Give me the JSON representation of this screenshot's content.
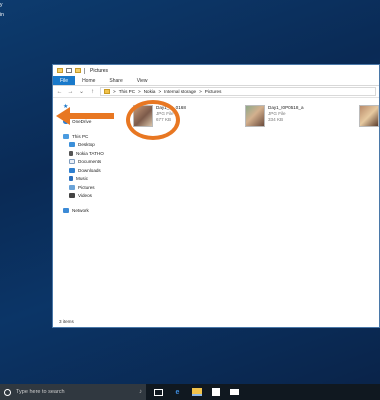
{
  "desktop": {
    "frag1": "y",
    "frag2": "in"
  },
  "window": {
    "title": "Pictures",
    "tabs": [
      "File",
      "Home",
      "Share",
      "View"
    ],
    "address": [
      "This PC",
      ">",
      "Nokia",
      ">",
      "Internal storage",
      ">",
      "Pictures"
    ],
    "nav": {
      "quick_access": "",
      "onedrive": "OneDrive",
      "this_pc": "This PC",
      "desktop": "Desktop",
      "nokia": "Nokia TATHO",
      "documents": "Documents",
      "downloads": "Downloads",
      "music": "Music",
      "pictures": "Pictures",
      "videos": "Videos",
      "network": "Network"
    },
    "files": [
      {
        "name": "Day1_I0_0168",
        "type": "JPG File",
        "size": "677 KB"
      },
      {
        "name": "Day1_I0P0518_a",
        "type": "JPG File",
        "size": "334 KB"
      },
      {
        "name": "",
        "type": "",
        "size": ""
      }
    ],
    "status": "3 items"
  },
  "taskbar": {
    "search_placeholder": "Type here to search"
  },
  "colors": {
    "accent": "#1979ca",
    "annotation": "#e87722",
    "desktop_bg": "#0b3567",
    "taskbar": "#101820"
  }
}
